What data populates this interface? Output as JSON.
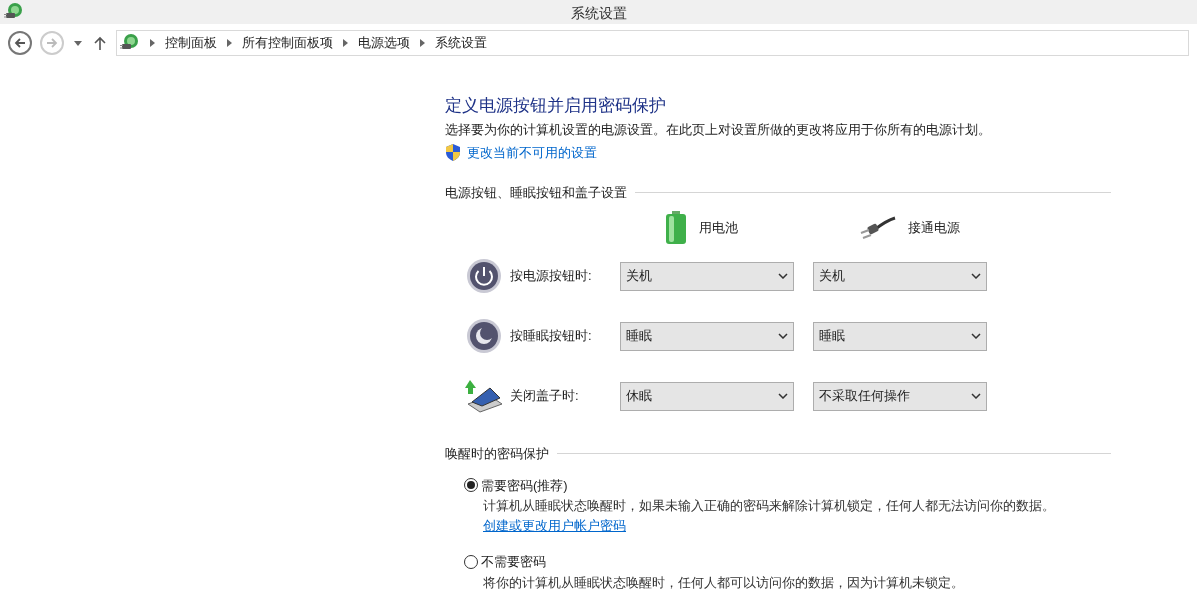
{
  "window": {
    "title": "系统设置"
  },
  "breadcrumb": [
    "控制面板",
    "所有控制面板项",
    "电源选项",
    "系统设置"
  ],
  "heading": "定义电源按钮并启用密码保护",
  "intro": "选择要为你的计算机设置的电源设置。在此页上对设置所做的更改将应用于你所有的电源计划。",
  "admin_link": "更改当前不可用的设置",
  "power_section": {
    "title": "电源按钮、睡眠按钮和盖子设置",
    "columns": [
      {
        "kind": "battery",
        "label": "用电池"
      },
      {
        "kind": "plug",
        "label": "接通电源"
      }
    ],
    "rows": [
      {
        "kind": "power",
        "label": "按电源按钮时:",
        "values": [
          "关机",
          "关机"
        ]
      },
      {
        "kind": "sleep",
        "label": "按睡眠按钮时:",
        "values": [
          "睡眠",
          "睡眠"
        ]
      },
      {
        "kind": "lid",
        "label": "关闭盖子时:",
        "values": [
          "休眠",
          "不采取任何操作"
        ]
      }
    ]
  },
  "password_section": {
    "title": "唤醒时的密码保护",
    "options": [
      {
        "label": "需要密码(推荐)",
        "selected": true,
        "description": "计算机从睡眠状态唤醒时，如果未输入正确的密码来解除计算机锁定，任何人都无法访问你的数据。",
        "link": "创建或更改用户帐户密码"
      },
      {
        "label": "不需要密码",
        "selected": false,
        "description": "将你的计算机从睡眠状态唤醒时，任何人都可以访问你的数据，因为计算机未锁定。"
      }
    ]
  }
}
